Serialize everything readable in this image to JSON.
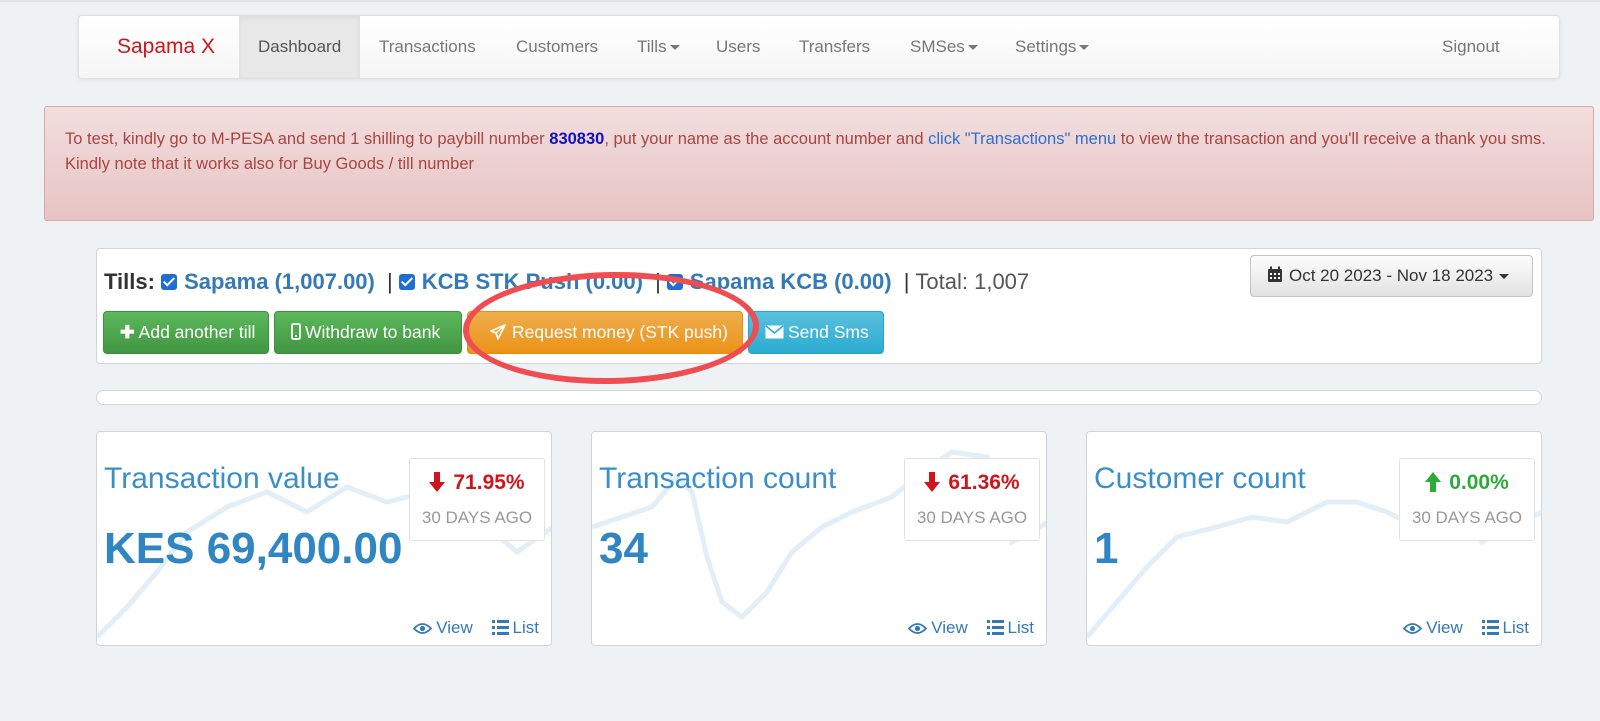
{
  "navbar": {
    "brand": "Sapama X",
    "items": [
      {
        "label": "Dashboard",
        "active": true,
        "dropdown": false
      },
      {
        "label": "Transactions",
        "dropdown": false
      },
      {
        "label": "Customers",
        "dropdown": false
      },
      {
        "label": "Tills",
        "dropdown": true
      },
      {
        "label": "Users",
        "dropdown": false
      },
      {
        "label": "Transfers",
        "dropdown": false
      },
      {
        "label": "SMSes",
        "dropdown": true
      },
      {
        "label": "Settings",
        "dropdown": true
      }
    ],
    "signout": "Signout"
  },
  "alert": {
    "text_1": "To test, kindly go to M-PESA and send 1 shilling to paybill number ",
    "paybill": "830830",
    "text_2": ", put your name as the account number and ",
    "link": "click \"Transactions\" menu",
    "text_3": " to view the transaction and you'll receive a thank you sms.",
    "note": "Kindly note that it works also for Buy Goods / till number"
  },
  "tills": {
    "label": "Tills:",
    "items": [
      {
        "name": "Sapama (1,007.00)",
        "checked": true
      },
      {
        "name": "KCB STK Push (0.00)",
        "checked": true
      },
      {
        "name": "Sapama KCB (0.00)",
        "checked": true
      }
    ],
    "separator": "|",
    "total": "Total: 1,007",
    "date_range": "Oct 20 2023 - Nov 18 2023",
    "buttons": {
      "add_till": "Add another till",
      "withdraw": "Withdraw to bank",
      "request_money": "Request money (STK push)",
      "send_sms": "Send Sms"
    }
  },
  "cards": [
    {
      "title": "Transaction value",
      "value": "KES 69,400.00",
      "change": "71.95%",
      "direction": "down",
      "change_label": "30 DAYS AGO",
      "view": "View",
      "list": "List"
    },
    {
      "title": "Transaction count",
      "value": "34",
      "change": "61.36%",
      "direction": "down",
      "change_label": "30 DAYS AGO",
      "view": "View",
      "list": "List"
    },
    {
      "title": "Customer count",
      "value": "1",
      "change": "0.00%",
      "direction": "up",
      "change_label": "30 DAYS AGO",
      "view": "View",
      "list": "List"
    }
  ],
  "colors": {
    "brand": "#d0141b",
    "link": "#337ab7",
    "down": "#d0141b",
    "up": "#2eaa3a",
    "annotation_circle": "#ef4d51"
  }
}
